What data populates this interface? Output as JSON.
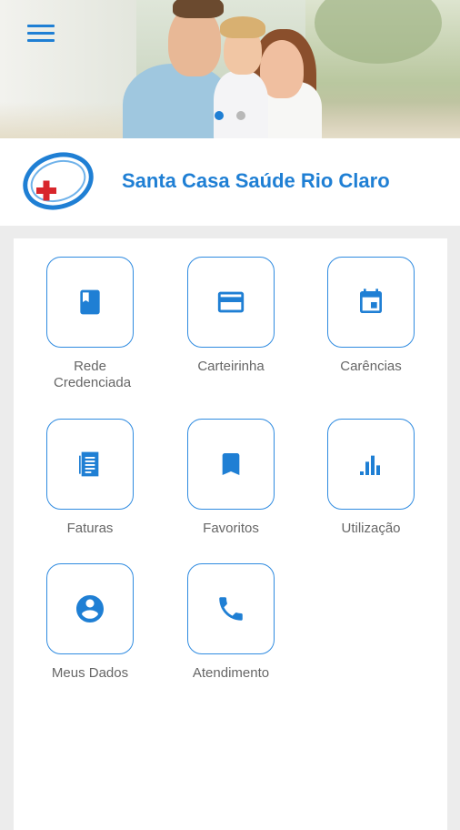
{
  "banner": {
    "slides": 2,
    "active_slide": 1
  },
  "header": {
    "title": "Santa Casa Saúde Rio Claro"
  },
  "menu": {
    "items": [
      {
        "label": "Rede Credenciada",
        "icon": "book-icon"
      },
      {
        "label": "Carteirinha",
        "icon": "credit-card-icon"
      },
      {
        "label": "Carências",
        "icon": "calendar-icon"
      },
      {
        "label": "Faturas",
        "icon": "document-list-icon"
      },
      {
        "label": "Favoritos",
        "icon": "bookmark-icon"
      },
      {
        "label": "Utilização",
        "icon": "bar-chart-icon"
      },
      {
        "label": "Meus Dados",
        "icon": "account-icon"
      },
      {
        "label": "Atendimento",
        "icon": "phone-icon"
      }
    ]
  },
  "colors": {
    "accent": "#1f7fd4",
    "tile_border": "#2f8be0",
    "label": "#666666",
    "background": "#ececec"
  }
}
